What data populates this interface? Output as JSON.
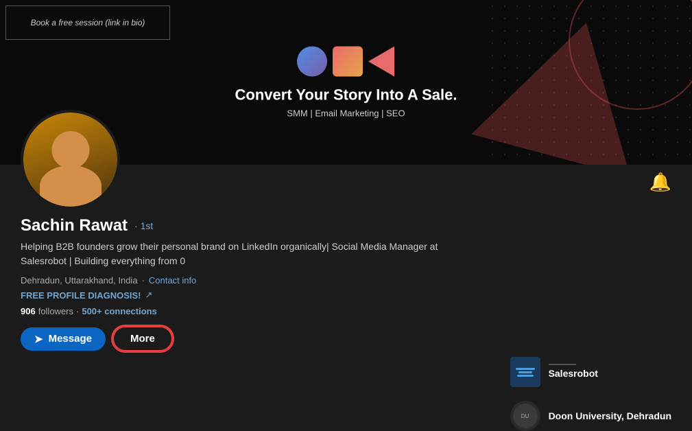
{
  "banner": {
    "ad_text": "Book a free session (link in bio)",
    "title": "Convert Your Story Into A Sale.",
    "subtitle": "SMM | Email Marketing |  SEO"
  },
  "notification": {
    "icon": "🔔"
  },
  "profile": {
    "name": "Sachin Rawat",
    "connection": "· 1st",
    "headline": "Helping B2B founders grow their personal brand on LinkedIn organically| Social Media Manager at Salesrobot | Building everything from 0",
    "location": "Dehradun, Uttarakhand, India",
    "contact_link": "Contact info",
    "free_diagnosis": "FREE PROFILE DIAGNOSIS!",
    "followers": "906",
    "followers_label": "followers",
    "connections": "500+ connections",
    "message_btn": "Message",
    "more_btn": "More"
  },
  "companies": [
    {
      "name": "Salesrobot",
      "type": "salesrobot"
    },
    {
      "name": "Doon University, Dehradun",
      "type": "doon"
    }
  ]
}
